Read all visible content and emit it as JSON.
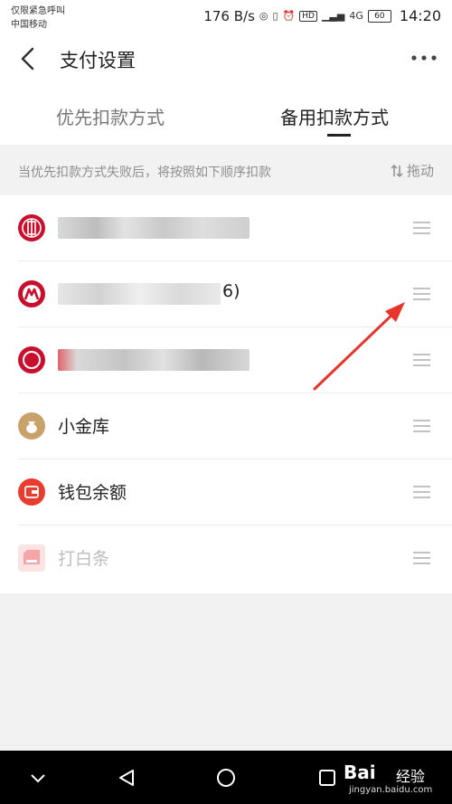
{
  "status_bar": {
    "carrier_line1": "仅限紧急呼叫",
    "carrier_line2": "中国移动",
    "speed": "176 B/s",
    "hd_badge": "HD",
    "network": "4G",
    "battery": "60",
    "time": "14:20"
  },
  "header": {
    "title": "支付设置",
    "back_icon": "chevron-left-icon",
    "more_icon": "more-horizontal-icon"
  },
  "tabs": [
    {
      "label": "优先扣款方式",
      "active": false
    },
    {
      "label": "备用扣款方式",
      "active": true
    }
  ],
  "hint": {
    "text": "当优先扣款方式失败后，将按照如下顺序扣款",
    "drag_label": "拖动"
  },
  "payment_methods": [
    {
      "label": "",
      "icon": "citic-bank-icon",
      "obscured": true,
      "suffix": ""
    },
    {
      "label": "",
      "icon": "cmb-bank-icon",
      "obscured": true,
      "suffix": "6)"
    },
    {
      "label": "",
      "icon": "bank-card-icon",
      "obscured": true,
      "suffix": ""
    },
    {
      "label": "小金库",
      "icon": "money-bag-icon",
      "obscured": false,
      "suffix": ""
    },
    {
      "label": "钱包余额",
      "icon": "wallet-icon",
      "obscured": false,
      "suffix": ""
    },
    {
      "label": "打白条",
      "icon": "baitiao-icon",
      "obscured": false,
      "faded": true,
      "suffix": ""
    }
  ],
  "colors": {
    "citic_red": "#c8102e",
    "cmb_red": "#c8102e",
    "gold": "#c9a26b",
    "wallet_red": "#e93b2e",
    "baitiao_pink": "#f5a5a5",
    "arrow_red": "#e8352a"
  },
  "watermark": {
    "logo": "Bai",
    "jing": "经验",
    "url": "jingyan.baidu.com"
  }
}
